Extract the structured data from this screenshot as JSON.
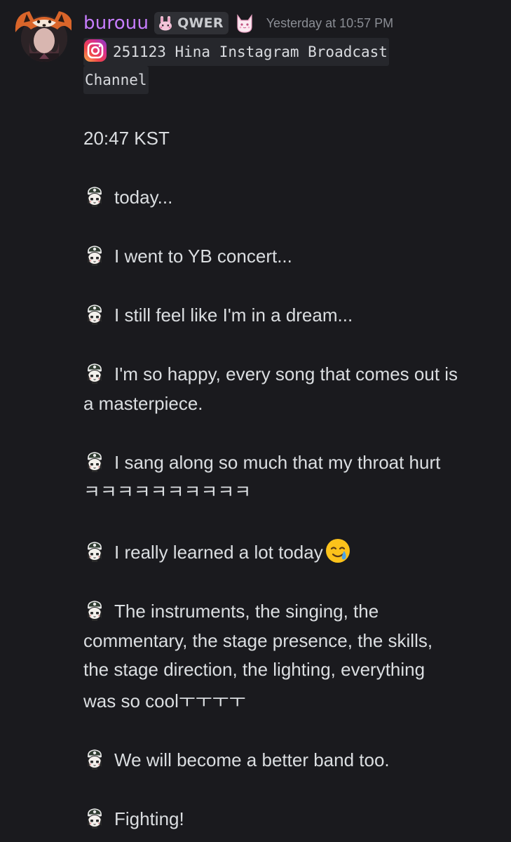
{
  "message": {
    "author": {
      "username": "burouu",
      "server_tag": "QWER",
      "avatar_icon": "fox-hood-avatar",
      "tag_icon": "bunny-icon",
      "role_icon": "cat-icon",
      "username_color": "#c77dff"
    },
    "timestamp": "Yesterday at 10:57 PM",
    "code_block": {
      "icon": "instagram-icon",
      "line1": "251123 Hina Instagram Broadcast",
      "line2": "Channel"
    },
    "time_line": "20:47 KST",
    "emote_icon": "hina-chibi-emote",
    "posts": [
      {
        "text": "today..."
      },
      {
        "text": "I went to YB concert..."
      },
      {
        "text": "I still feel like I'm in a dream..."
      },
      {
        "text": "I'm so happy, every song that comes out is",
        "continuation": "a masterpiece."
      },
      {
        "text": "I sang along so much that my throat hurt",
        "continuation": "ㅋㅋㅋㅋㅋㅋㅋㅋㅋㅋ"
      },
      {
        "text": "I really learned a lot today",
        "emoji": "smiling-face-with-tear-emoji"
      },
      {
        "text": "The instruments, the singing, the",
        "continuation": "commentary, the stage presence, the skills,",
        "continuation2": "the stage direction, the lighting, everything",
        "continuation3": "was so coolㅜㅜㅜㅜ"
      },
      {
        "text": "We will become a better band too."
      },
      {
        "text": "Fighting!"
      }
    ]
  }
}
